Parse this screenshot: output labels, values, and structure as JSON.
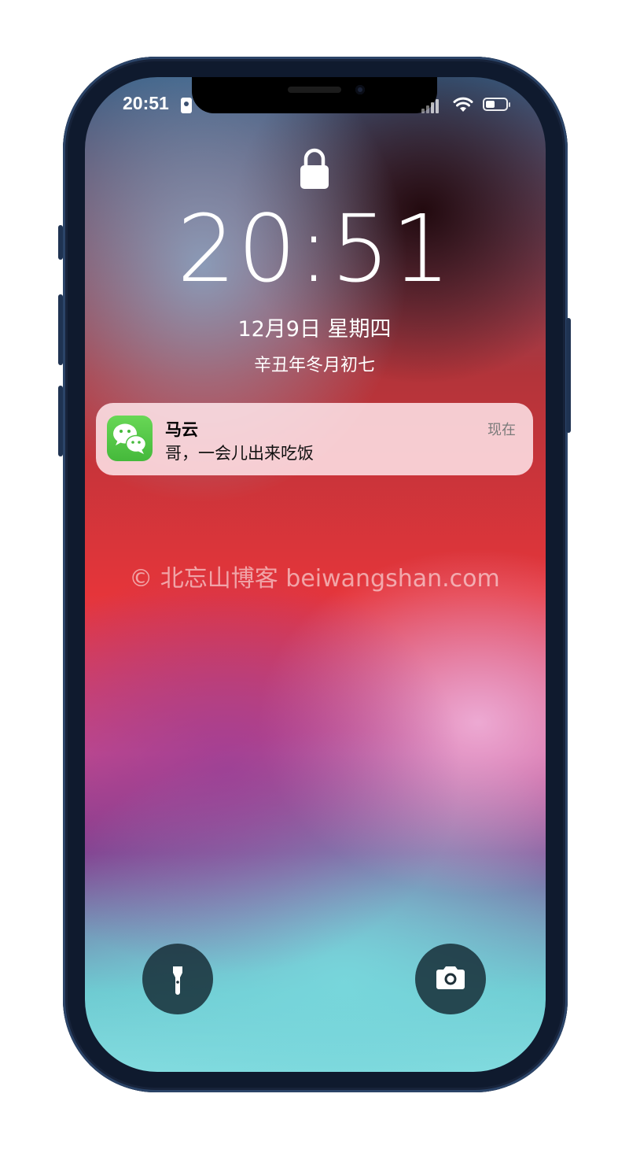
{
  "status_bar": {
    "time": "20:51",
    "battery_level": 0.45
  },
  "lock_screen": {
    "time": "20:51",
    "date": "12月9日 星期四",
    "lunar_date": "辛丑年冬月初七"
  },
  "notification": {
    "app_icon": "wechat-icon",
    "title": "马云",
    "message": "哥，一会儿出来吃饭",
    "time": "现在"
  },
  "watermark": "© 北忘山博客 beiwangshan.com",
  "quick_actions": {
    "left_icon": "flashlight-icon",
    "right_icon": "camera-icon"
  },
  "colors": {
    "phone_frame": "#0f1a2e",
    "wechat_green": "#4fc443"
  }
}
